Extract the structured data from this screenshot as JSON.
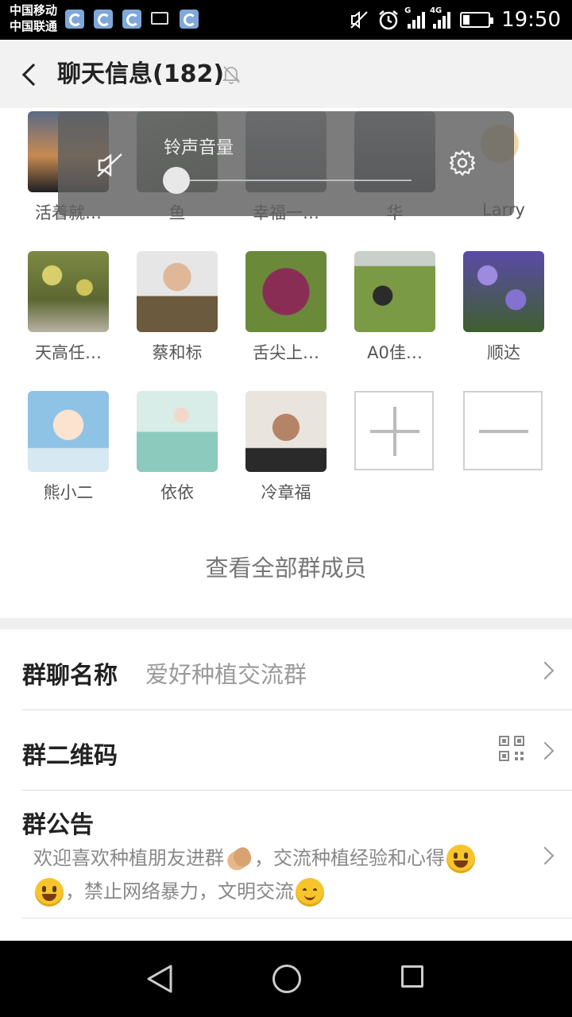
{
  "status_bar": {
    "carrier1": "中国移动",
    "carrier2": "中国联通",
    "network1": "G",
    "network2": "4G",
    "time": "19:50"
  },
  "header": {
    "title": "聊天信息(182)"
  },
  "members": [
    {
      "name": "活着就…",
      "color": "#303744"
    },
    {
      "name": "鱼",
      "color": "#5a6b57"
    },
    {
      "name": "幸福一…",
      "color": "#6d6f73"
    },
    {
      "name": "华",
      "color": "#4b5259"
    },
    {
      "name": "Larry",
      "color": "#e7d49c"
    },
    {
      "name": "天高任…",
      "color": "#9aa44e"
    },
    {
      "name": "蔡和标",
      "color": "#6b5a3e"
    },
    {
      "name": "舌尖上…",
      "color": "#7a2a4f"
    },
    {
      "name": "A0佳…",
      "color": "#6a8a3a"
    },
    {
      "name": "顺达",
      "color": "#6b58b5"
    },
    {
      "name": "熊小二",
      "color": "#8fc3e6"
    },
    {
      "name": "依依",
      "color": "#b9d7cf"
    },
    {
      "name": "冷章福",
      "color": "#5b4a3c"
    }
  ],
  "view_all": "查看全部群成员",
  "volume": {
    "label": "铃声音量",
    "level": 0
  },
  "settings": {
    "group_name_label": "群聊名称",
    "group_name_value": "爱好种植交流群",
    "qr_label": "群二维码",
    "notice_label": "群公告",
    "notice_part1": "欢迎喜欢种植朋友进群",
    "notice_part2": "，交流种植经验和心得",
    "notice_part3": "，禁止网络暴力，文明交流"
  }
}
